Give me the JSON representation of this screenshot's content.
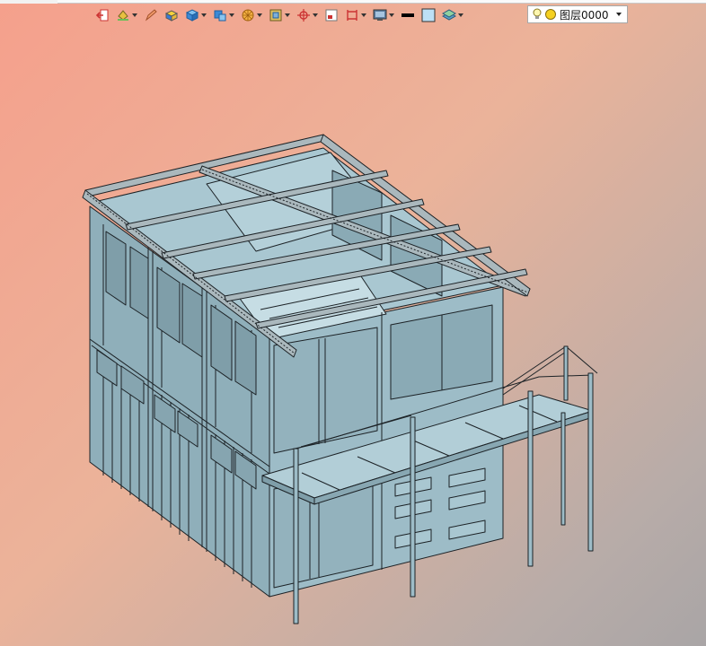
{
  "toolbar": {
    "tools": [
      "exit-icon",
      "paint-bucket-icon",
      "pencil-icon",
      "solid-block-icon",
      "cube-icon",
      "extrude-icon",
      "pie-render-icon",
      "box-frame-icon",
      "crosshair-icon",
      "layer-panel-icon",
      "dimension-icon",
      "monitor-icon",
      "line-color-icon",
      "fill-color-icon",
      "stack-layers-icon"
    ],
    "layer_select": {
      "value": "图层0000",
      "bulb_icon": "lightbulb-icon",
      "sun_icon": "sun-icon"
    }
  },
  "viewport": {
    "gradient_colors": [
      "#f5a08c",
      "#ebb39a",
      "#b8aca8",
      "#a9a5a6"
    ],
    "model_color": "#94b4bf",
    "model_light": "#a8c6d0",
    "edge_color": "#1c2226"
  }
}
